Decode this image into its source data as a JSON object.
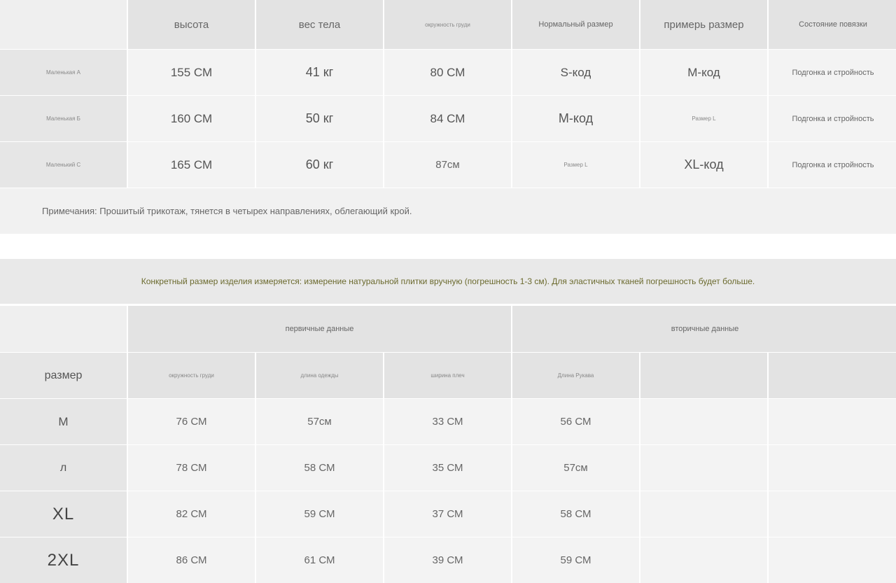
{
  "table1": {
    "headers": [
      "высота",
      "вес тела",
      "окружность груди",
      "Нормальный размер",
      "примерь размер",
      "Состояние повязки"
    ],
    "rows": [
      {
        "label": "Маленькая А",
        "cells": [
          "155 СМ",
          "41 кг",
          "80 СМ",
          "S-код",
          "М-код",
          "Подгонка и стройность"
        ]
      },
      {
        "label": "Маленькая Б",
        "cells": [
          "160 СМ",
          "50 кг",
          "84 СМ",
          "М-код",
          "Размер L",
          "Подгонка и стройность"
        ]
      },
      {
        "label": "Маленький С",
        "cells": [
          "165 СМ",
          "60 кг",
          "87см",
          "Размер L",
          "XL-код",
          "Подгонка и стройность"
        ]
      }
    ],
    "note": "Примечания: Прошитый трикотаж, тянется в четырех направлениях, облегающий крой."
  },
  "banner": "Конкретный размер изделия измеряется: измерение натуральной плитки вручную (погрешность 1-3 см). Для эластичных тканей погрешность будет больше.",
  "table2": {
    "group_primary": "первичные данные",
    "group_secondary": "вторичные данные",
    "size_header": "размер",
    "columns": [
      "окружность груди",
      "длина одежды",
      "ширина плеч",
      "Длина Рукава",
      "",
      ""
    ],
    "rows": [
      {
        "size": "М",
        "cells": [
          "76 СМ",
          "57см",
          "33 СМ",
          "56 СМ",
          "",
          ""
        ]
      },
      {
        "size": "л",
        "cells": [
          "78 СМ",
          "58 СМ",
          "35 СМ",
          "57см",
          "",
          ""
        ]
      },
      {
        "size": "XL",
        "cells": [
          "82 СМ",
          "59 СМ",
          "37 СМ",
          "58 СМ",
          "",
          ""
        ]
      },
      {
        "size": "2XL",
        "cells": [
          "86 СМ",
          "61 СМ",
          "39 СМ",
          "59 СМ",
          "",
          ""
        ]
      }
    ]
  }
}
